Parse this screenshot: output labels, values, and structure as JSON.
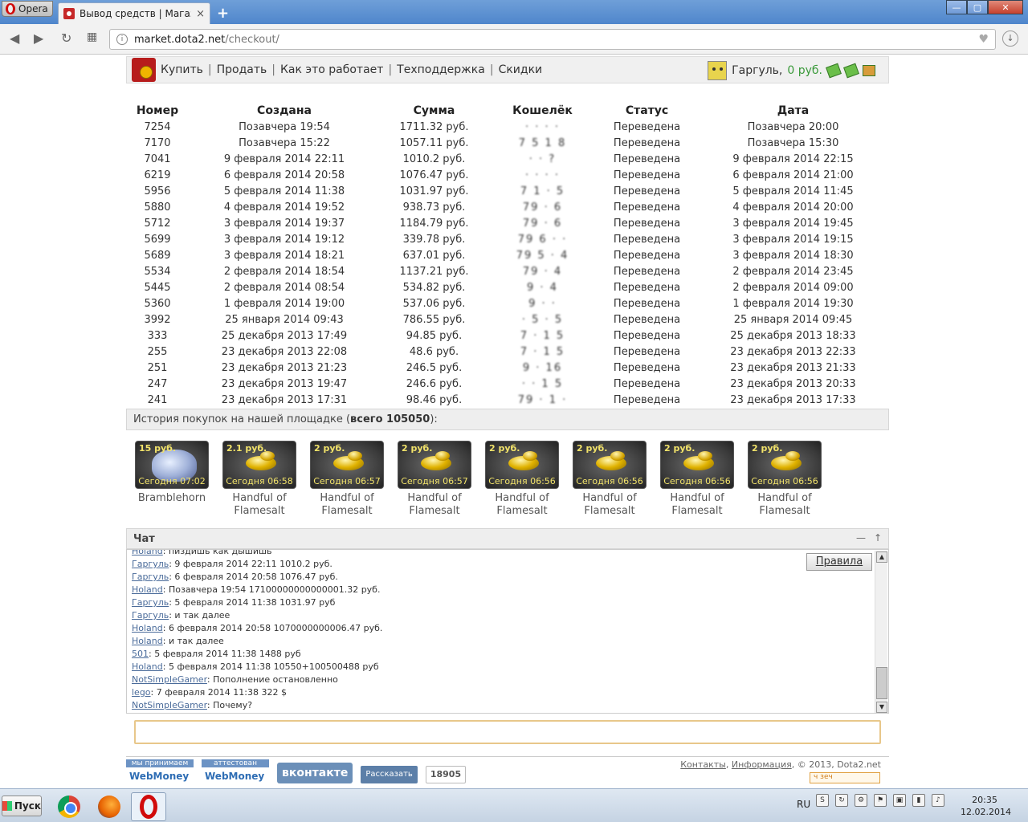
{
  "browser": {
    "menu_label": "Opera",
    "tab_title": "Вывод средств | Магазин",
    "tab_close": "×",
    "new_tab": "+",
    "url_host": "market.dota2.net",
    "url_path": "/checkout/",
    "win_minimize": "—",
    "win_maximize": "▢",
    "win_close": "✕"
  },
  "header": {
    "menu": [
      "Купить",
      "Продать",
      "Как это работает",
      "Техподдержка",
      "Скидки"
    ],
    "separator": "|",
    "username": "Гаргуль,",
    "balance": "0 руб."
  },
  "table": {
    "headers": [
      "Номер",
      "Создана",
      "Сумма",
      "Кошелёк",
      "Статус",
      "Дата"
    ],
    "rows": [
      [
        "7254",
        "Позавчера 19:54",
        "1711.32 руб.",
        "· · · ·",
        "Переведена",
        "Позавчера 20:00"
      ],
      [
        "7170",
        "Позавчера 15:22",
        "1057.11 руб.",
        "7 5 1 8",
        "Переведена",
        "Позавчера 15:30"
      ],
      [
        "7041",
        "9 февраля 2014 22:11",
        "1010.2 руб.",
        "· · ?",
        "Переведена",
        "9 февраля 2014 22:15"
      ],
      [
        "6219",
        "6 февраля 2014 20:58",
        "1076.47 руб.",
        "· · · ·",
        "Переведена",
        "6 февраля 2014 21:00"
      ],
      [
        "5956",
        "5 февраля 2014 11:38",
        "1031.97 руб.",
        "7 1 · 5",
        "Переведена",
        "5 февраля 2014 11:45"
      ],
      [
        "5880",
        "4 февраля 2014 19:52",
        "938.73 руб.",
        "79 · 6",
        "Переведена",
        "4 февраля 2014 20:00"
      ],
      [
        "5712",
        "3 февраля 2014 19:37",
        "1184.79 руб.",
        "79 · 6",
        "Переведена",
        "3 февраля 2014 19:45"
      ],
      [
        "5699",
        "3 февраля 2014 19:12",
        "339.78 руб.",
        "79 6 · ·",
        "Переведена",
        "3 февраля 2014 19:15"
      ],
      [
        "5689",
        "3 февраля 2014 18:21",
        "637.01 руб.",
        "79 5 · 4",
        "Переведена",
        "3 февраля 2014 18:30"
      ],
      [
        "5534",
        "2 февраля 2014 18:54",
        "1137.21 руб.",
        "79 · 4",
        "Переведена",
        "2 февраля 2014 23:45"
      ],
      [
        "5445",
        "2 февраля 2014 08:54",
        "534.82 руб.",
        "9 · 4",
        "Переведена",
        "2 февраля 2014 09:00"
      ],
      [
        "5360",
        "1 февраля 2014 19:00",
        "537.06 руб.",
        "9 · ·",
        "Переведена",
        "1 февраля 2014 19:30"
      ],
      [
        "3992",
        "25 января 2014 09:43",
        "786.55 руб.",
        "· 5 · 5",
        "Переведена",
        "25 января 2014 09:45"
      ],
      [
        "333",
        "25 декабря 2013 17:49",
        "94.85 руб.",
        "7 · 1 5",
        "Переведена",
        "25 декабря 2013 18:33"
      ],
      [
        "255",
        "23 декабря 2013 22:08",
        "48.6 руб.",
        "7 · 1 5",
        "Переведена",
        "23 декабря 2013 22:33"
      ],
      [
        "251",
        "23 декабря 2013 21:23",
        "246.5 руб.",
        "9 · 16",
        "Переведена",
        "23 декабря 2013 21:33"
      ],
      [
        "247",
        "23 декабря 2013 19:47",
        "246.6 руб.",
        "· · 1 5",
        "Переведена",
        "23 декабря 2013 20:33"
      ],
      [
        "241",
        "23 декабря 2013 17:31",
        "98.46 руб.",
        "79 · 1 ·",
        "Переведена",
        "23 декабря 2013 17:33"
      ]
    ]
  },
  "history": {
    "label": "История покупок на нашей площадке (",
    "total": "всего 105050",
    "suffix": "):"
  },
  "purchases": [
    {
      "price": "15 руб.",
      "time": "Сегодня 07:02",
      "name": "Bramblehorn",
      "icon": "creature-icon"
    },
    {
      "price": "2.1 руб.",
      "time": "Сегодня 06:58",
      "name": "Handful of Flamesalt",
      "icon": "flamesalt-icon"
    },
    {
      "price": "2 руб.",
      "time": "Сегодня 06:57",
      "name": "Handful of Flamesalt",
      "icon": "flamesalt-icon"
    },
    {
      "price": "2 руб.",
      "time": "Сегодня 06:57",
      "name": "Handful of Flamesalt",
      "icon": "flamesalt-icon"
    },
    {
      "price": "2 руб.",
      "time": "Сегодня 06:56",
      "name": "Handful of Flamesalt",
      "icon": "flamesalt-icon"
    },
    {
      "price": "2 руб.",
      "time": "Сегодня 06:56",
      "name": "Handful of Flamesalt",
      "icon": "flamesalt-icon"
    },
    {
      "price": "2 руб.",
      "time": "Сегодня 06:56",
      "name": "Handful of Flamesalt",
      "icon": "flamesalt-icon"
    },
    {
      "price": "2 руб.",
      "time": "Сегодня 06:56",
      "name": "Handful of Flamesalt",
      "icon": "flamesalt-icon"
    }
  ],
  "chat": {
    "title": "Чат",
    "collapse": "—",
    "up": "↑",
    "rules": "Правила",
    "messages": [
      {
        "nick": "Holand",
        "text": ": пиздишь как дышишь"
      },
      {
        "nick": "Гаргуль",
        "text": ": 9 февраля 2014 22:11 1010.2 руб."
      },
      {
        "nick": "Гаргуль",
        "text": ": 6 февраля 2014 20:58 1076.47 руб."
      },
      {
        "nick": "Holand",
        "text": ": Позавчера 19:54 17100000000000001.32 руб."
      },
      {
        "nick": "Гаргуль",
        "text": ": 5 февраля 2014 11:38 1031.97 руб"
      },
      {
        "nick": "Гаргуль",
        "text": ": и так далее"
      },
      {
        "nick": "Holand",
        "text": ": 6 февраля 2014 20:58 1070000000006.47 руб."
      },
      {
        "nick": "Holand",
        "text": ": и так далее"
      },
      {
        "nick": "501",
        "text": ": 5 февраля 2014 11:38 1488 руб"
      },
      {
        "nick": "Holand",
        "text": ": 5 февраля 2014 11:38 10550+100500488 руб"
      },
      {
        "nick": "NotSimpleGamer",
        "text": ": Пополнение остановленно"
      },
      {
        "nick": "lego",
        "text": ": 7 февраля 2014 11:38 322 $"
      },
      {
        "nick": "NotSimpleGamer",
        "text": ": Почему?"
      }
    ]
  },
  "footer": {
    "wm1_top": "мы принимаем",
    "wm1_bottom": "WebMoney",
    "wm2_top": "аттестован",
    "wm2_bottom": "WebMoney",
    "vk": "вконтакте",
    "share": "Рассказать",
    "share_count": "18905",
    "links": [
      "Контакты",
      "Информация"
    ],
    "copyright": ", © 2013, Dota2.net",
    "counter": "ч зеч"
  },
  "taskbar": {
    "start": "Пуск",
    "lang": "RU",
    "time": "20:35",
    "date": "12.02.2014"
  }
}
